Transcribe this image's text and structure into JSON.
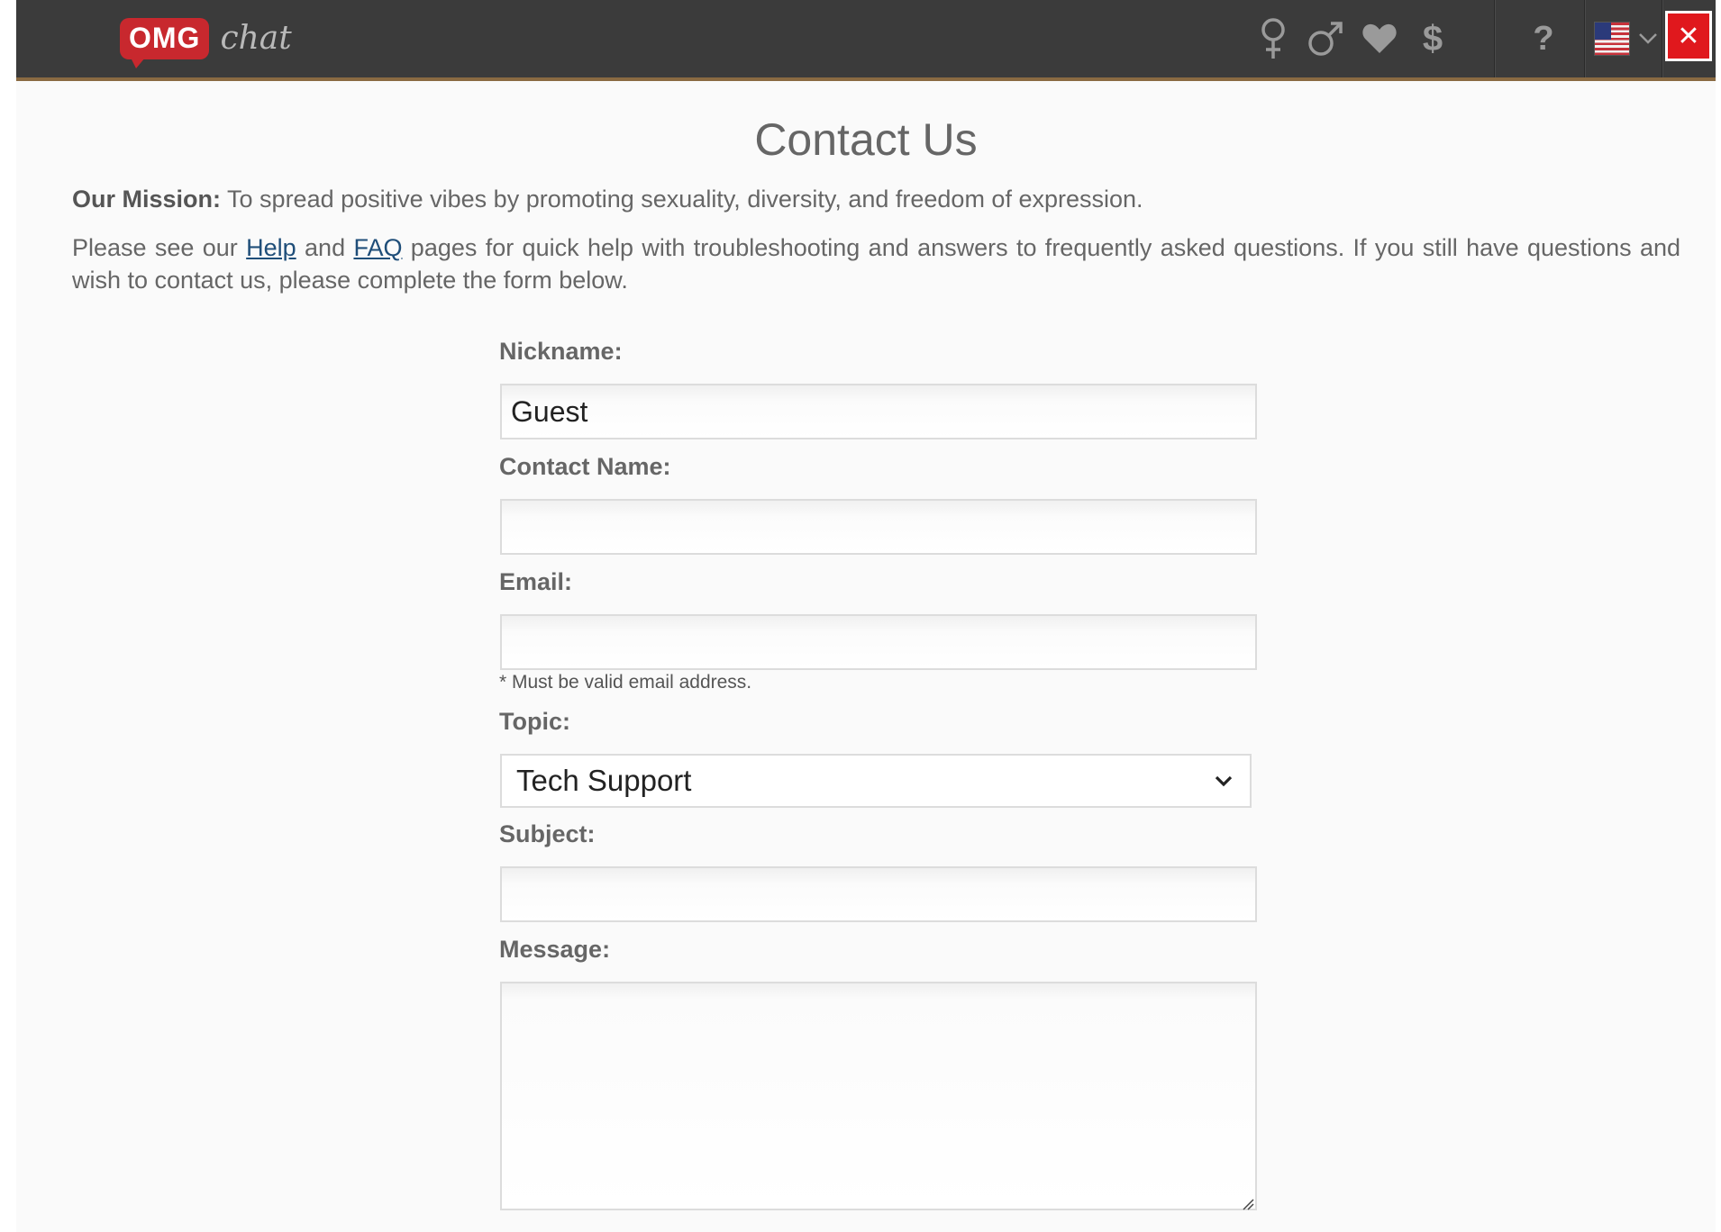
{
  "header": {
    "logo_badge": "OMG",
    "logo_text": "chat",
    "nav_icons": [
      "female-icon",
      "male-icon",
      "heart-icon",
      "dollar-icon",
      "help-icon",
      "us-flag-icon",
      "chevron-down-icon"
    ],
    "close_label": "✕"
  },
  "page": {
    "title": "Contact Us",
    "mission_label": "Our Mission:",
    "mission_text": " To spread positive vibes by promoting sexuality, diversity, and freedom of expression.",
    "help_prefix": "Please see our ",
    "help_link": "Help",
    "help_mid": " and ",
    "faq_link": "FAQ",
    "help_suffix": " pages for quick help with troubleshooting and answers to frequently asked questions. If you still have questions and wish to contact us, please complete the form below."
  },
  "form": {
    "nickname_label": "Nickname:",
    "nickname_value": "Guest",
    "contact_name_label": "Contact Name:",
    "contact_name_value": "",
    "email_label": "Email:",
    "email_value": "",
    "email_hint": "* Must be valid email address.",
    "topic_label": "Topic:",
    "topic_selected": "Tech Support",
    "subject_label": "Subject:",
    "subject_value": "",
    "message_label": "Message:",
    "message_value": ""
  },
  "colors": {
    "topbar": "#3b3b3b",
    "accent_border": "#8a6a42",
    "close_button": "#e0181d",
    "logo_red": "#c8282e",
    "link": "#1f4e79"
  }
}
